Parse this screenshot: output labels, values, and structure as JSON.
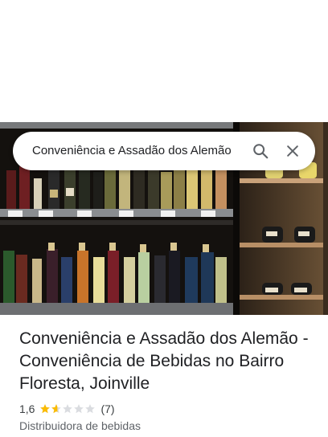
{
  "search": {
    "query": "Conveniência e Assadão dos Alemão"
  },
  "place": {
    "title": "Conveniência e Assadão dos Alemão - Conveniência de Bebidas no Bairro Floresta, Joinville",
    "rating": "1,6",
    "rating_value": 1.6,
    "rating_max": 5,
    "review_count": "(7)",
    "category": "Distribuidora de bebidas"
  },
  "icons": {
    "search": "search-icon",
    "close": "close-icon",
    "star": "star-icon"
  },
  "colors": {
    "star_filled": "#fbbc04",
    "star_empty": "#dadce0",
    "icon": "#5f6368"
  }
}
